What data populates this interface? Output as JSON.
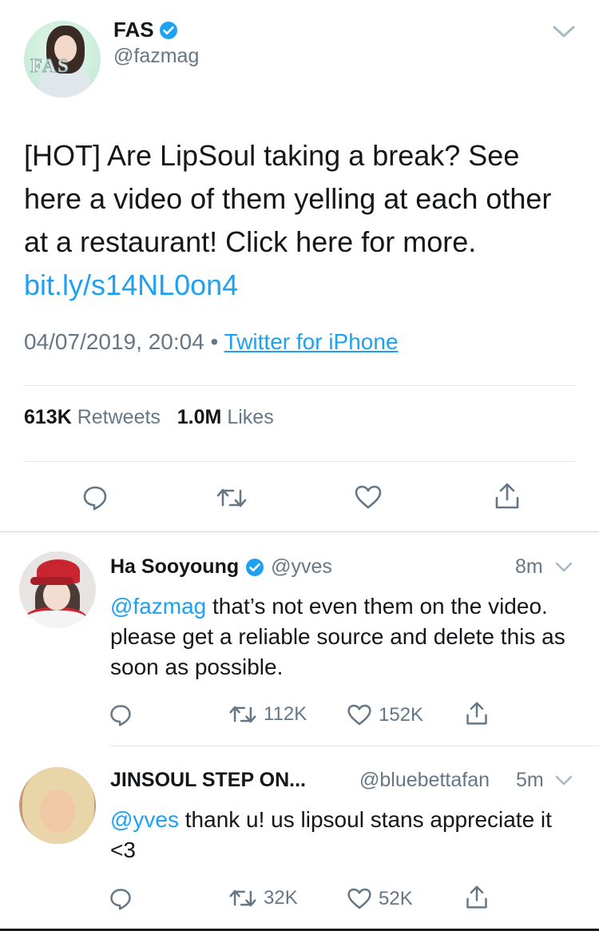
{
  "main_tweet": {
    "display_name": "FAS",
    "handle": "@fazmag",
    "avatar_watermark": "FAS",
    "text": "[HOT] Are LipSoul taking a break? See here a video of them yelling at each other at a restaurant! Click here for more. ",
    "link": "bit.ly/s14NL0on4",
    "timestamp": "04/07/2019, 20:04",
    "separator": "•",
    "source": "Twitter for iPhone",
    "retweets_count": "613K",
    "retweets_label": "Retweets",
    "likes_count": "1.0M",
    "likes_label": "Likes"
  },
  "replies": [
    {
      "display_name": "Ha Sooyoung",
      "verified": true,
      "handle": "@yves",
      "time": "8m",
      "mention": "@fazmag",
      "text": " that’s not even them on the video. please get a reliable source and delete this as soon as possible.",
      "retweets": "112K",
      "likes": "152K"
    },
    {
      "display_name": "JINSOUL STEP ON...",
      "verified": false,
      "handle": "@bluebettafan",
      "time": "5m",
      "mention": "@yves",
      "text": " thank u! us lipsoul stans appreciate it <3",
      "retweets": "32K",
      "likes": "52K"
    }
  ],
  "icons": {
    "reply": "reply-icon",
    "retweet": "retweet-icon",
    "like": "heart-icon",
    "share": "share-icon",
    "verified": "verified-badge-icon",
    "menu": "chevron-down-icon"
  },
  "colors": {
    "link": "#1da1f2",
    "text": "#14171a",
    "secondary": "#657786",
    "divider": "#e1e8ed"
  }
}
